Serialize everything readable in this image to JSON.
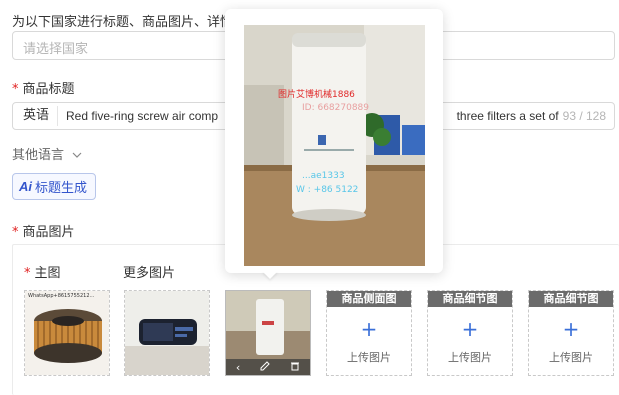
{
  "country": {
    "instruction": "为以下国家进行标题、商品图片、详情",
    "placeholder": "请选择国家"
  },
  "title_section": {
    "label": "商品标题",
    "language": "英语",
    "value_left": "Red five-ring screw air comp",
    "value_right": "three filters a set of",
    "counter": "93 / 128",
    "other_languages": "其他语言",
    "ai_button": "标题生成",
    "ai_icon_text": "Ai"
  },
  "images_section": {
    "label": "商品图片",
    "main_label": "主图",
    "more_label": "更多图片",
    "slots": [
      {
        "title": "商品侧面图",
        "upload": "上传图片"
      },
      {
        "title": "商品细节图",
        "upload": "上传图片"
      },
      {
        "title": "商品细节图",
        "upload": "上传图片"
      }
    ]
  },
  "watermark": {
    "line1": "图片艾博机械1886",
    "line2": "ID: 668270889",
    "line3": "...ae1333",
    "line4": "W : +86  5122",
    "thumb_text": "WhatsApp+8615755212..."
  },
  "colors": {
    "required": "#e02020",
    "accent": "#3355cc",
    "plus": "#3a6fd8"
  }
}
